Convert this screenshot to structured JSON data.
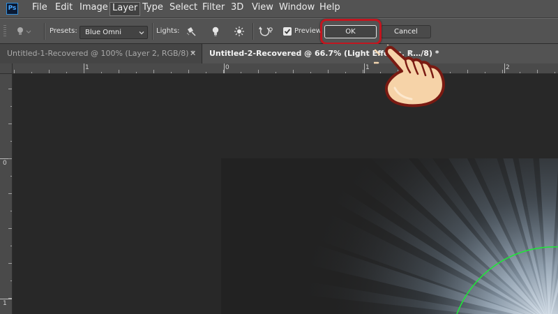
{
  "app": {
    "logo_text": "Ps",
    "menu": [
      "File",
      "Edit",
      "Image",
      "Layer",
      "Type",
      "Select",
      "Filter",
      "3D",
      "View",
      "Window",
      "Help"
    ],
    "active_menu": "Layer"
  },
  "options_bar": {
    "presets_label": "Presets:",
    "presets_value": "Blue Omni",
    "lights_label": "Lights:",
    "preview_label": "Preview",
    "preview_checked": true,
    "ok_label": "OK",
    "cancel_label": "Cancel",
    "highlight_color": "#c2161f"
  },
  "tabs": [
    {
      "title": "Untitled-1-Recovered @ 100% (Layer 2, RGB/8) *",
      "active": false,
      "close": "✕"
    },
    {
      "title": "Untitled-2-Recovered @ 66.7% (Light Effects, R…/8) *",
      "active": true,
      "close": "✕"
    }
  ],
  "rulers": {
    "horizontal_labels": [
      "1",
      "0",
      "1",
      "2"
    ],
    "vertical_labels": [
      "0",
      "1"
    ]
  },
  "canvas": {
    "background_color": "#1f1f1f",
    "light_color": "#b8cfe6",
    "light_circle_color": "#22e33b"
  },
  "icons": {
    "light_bulb_dim": "light-bulb-icon",
    "spot_light": "spot-light-icon",
    "point_light": "point-light-icon",
    "infinite_light": "infinite-light-icon",
    "reset_light": "reset-light-icon",
    "pointing_hand": "pointing-hand-icon"
  }
}
